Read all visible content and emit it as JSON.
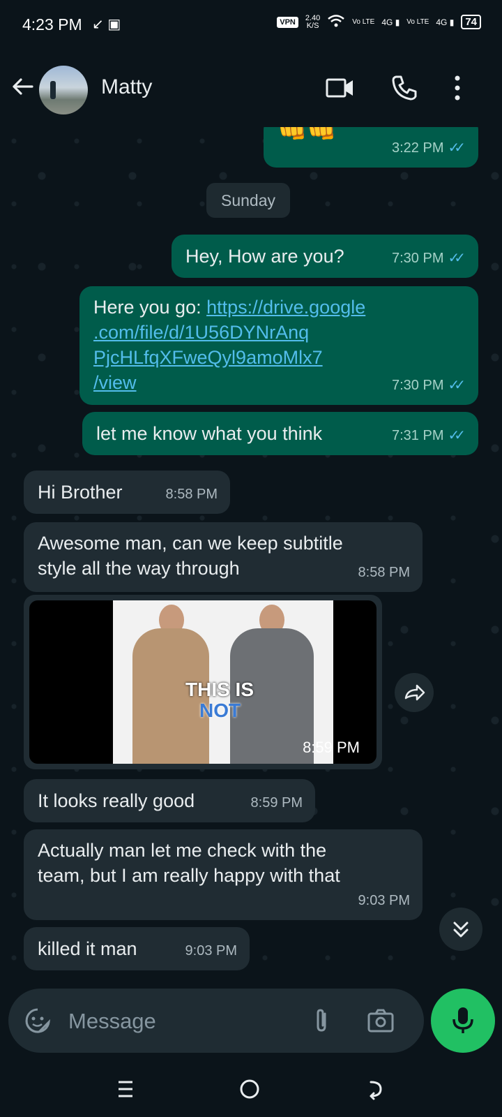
{
  "status_bar": {
    "time": "4:23 PM",
    "vpn": "VPN",
    "speed_value": "2.40",
    "speed_unit": "K/S",
    "volte1": "Vo LTE",
    "net1": "4G",
    "volte2": "Vo LTE",
    "net2": "4G",
    "battery": "74"
  },
  "header": {
    "contact_name": "Matty",
    "icons": [
      "back-arrow-icon",
      "video-call-icon",
      "phone-icon",
      "more-vert-icon"
    ]
  },
  "chat": {
    "top_partial": {
      "emoji": "👊👊",
      "time": "3:22 PM"
    },
    "day_label": "Sunday",
    "messages": [
      {
        "dir": "out",
        "text": "Hey, How are you?",
        "time": "7:30 PM"
      },
      {
        "dir": "out",
        "prefix": "Here you go: ",
        "link_lines": [
          "https://drive.google",
          ".com/file/d/1U56DYNrAnq",
          "PjcHLfqXFweQyl9amoMlx7",
          "/view"
        ],
        "time": "7:30 PM"
      },
      {
        "dir": "out",
        "text": "let me know what you think",
        "time": "7:31 PM"
      },
      {
        "dir": "in",
        "text": "Hi Brother",
        "time": "8:58 PM"
      },
      {
        "dir": "in",
        "text_lines": [
          "Awesome man, can we keep subtitle",
          "style all the way through"
        ],
        "time": "8:58 PM"
      },
      {
        "dir": "in",
        "type": "video",
        "caption_line1": "THIS IS",
        "caption_line2": "NOT",
        "time": "8:59 PM"
      },
      {
        "dir": "in",
        "text": "It looks really good",
        "time": "8:59 PM"
      },
      {
        "dir": "in",
        "text_lines": [
          "Actually man let me check with the",
          "team, but I am really happy with that"
        ],
        "time": "9:03 PM"
      },
      {
        "dir": "in",
        "text": "killed it man",
        "time": "9:03 PM"
      }
    ]
  },
  "composer": {
    "placeholder": "Message"
  },
  "colors": {
    "outgoing": "#005c4b",
    "incoming": "#202c33",
    "accent": "#21c063",
    "ticks": "#53bdeb"
  }
}
